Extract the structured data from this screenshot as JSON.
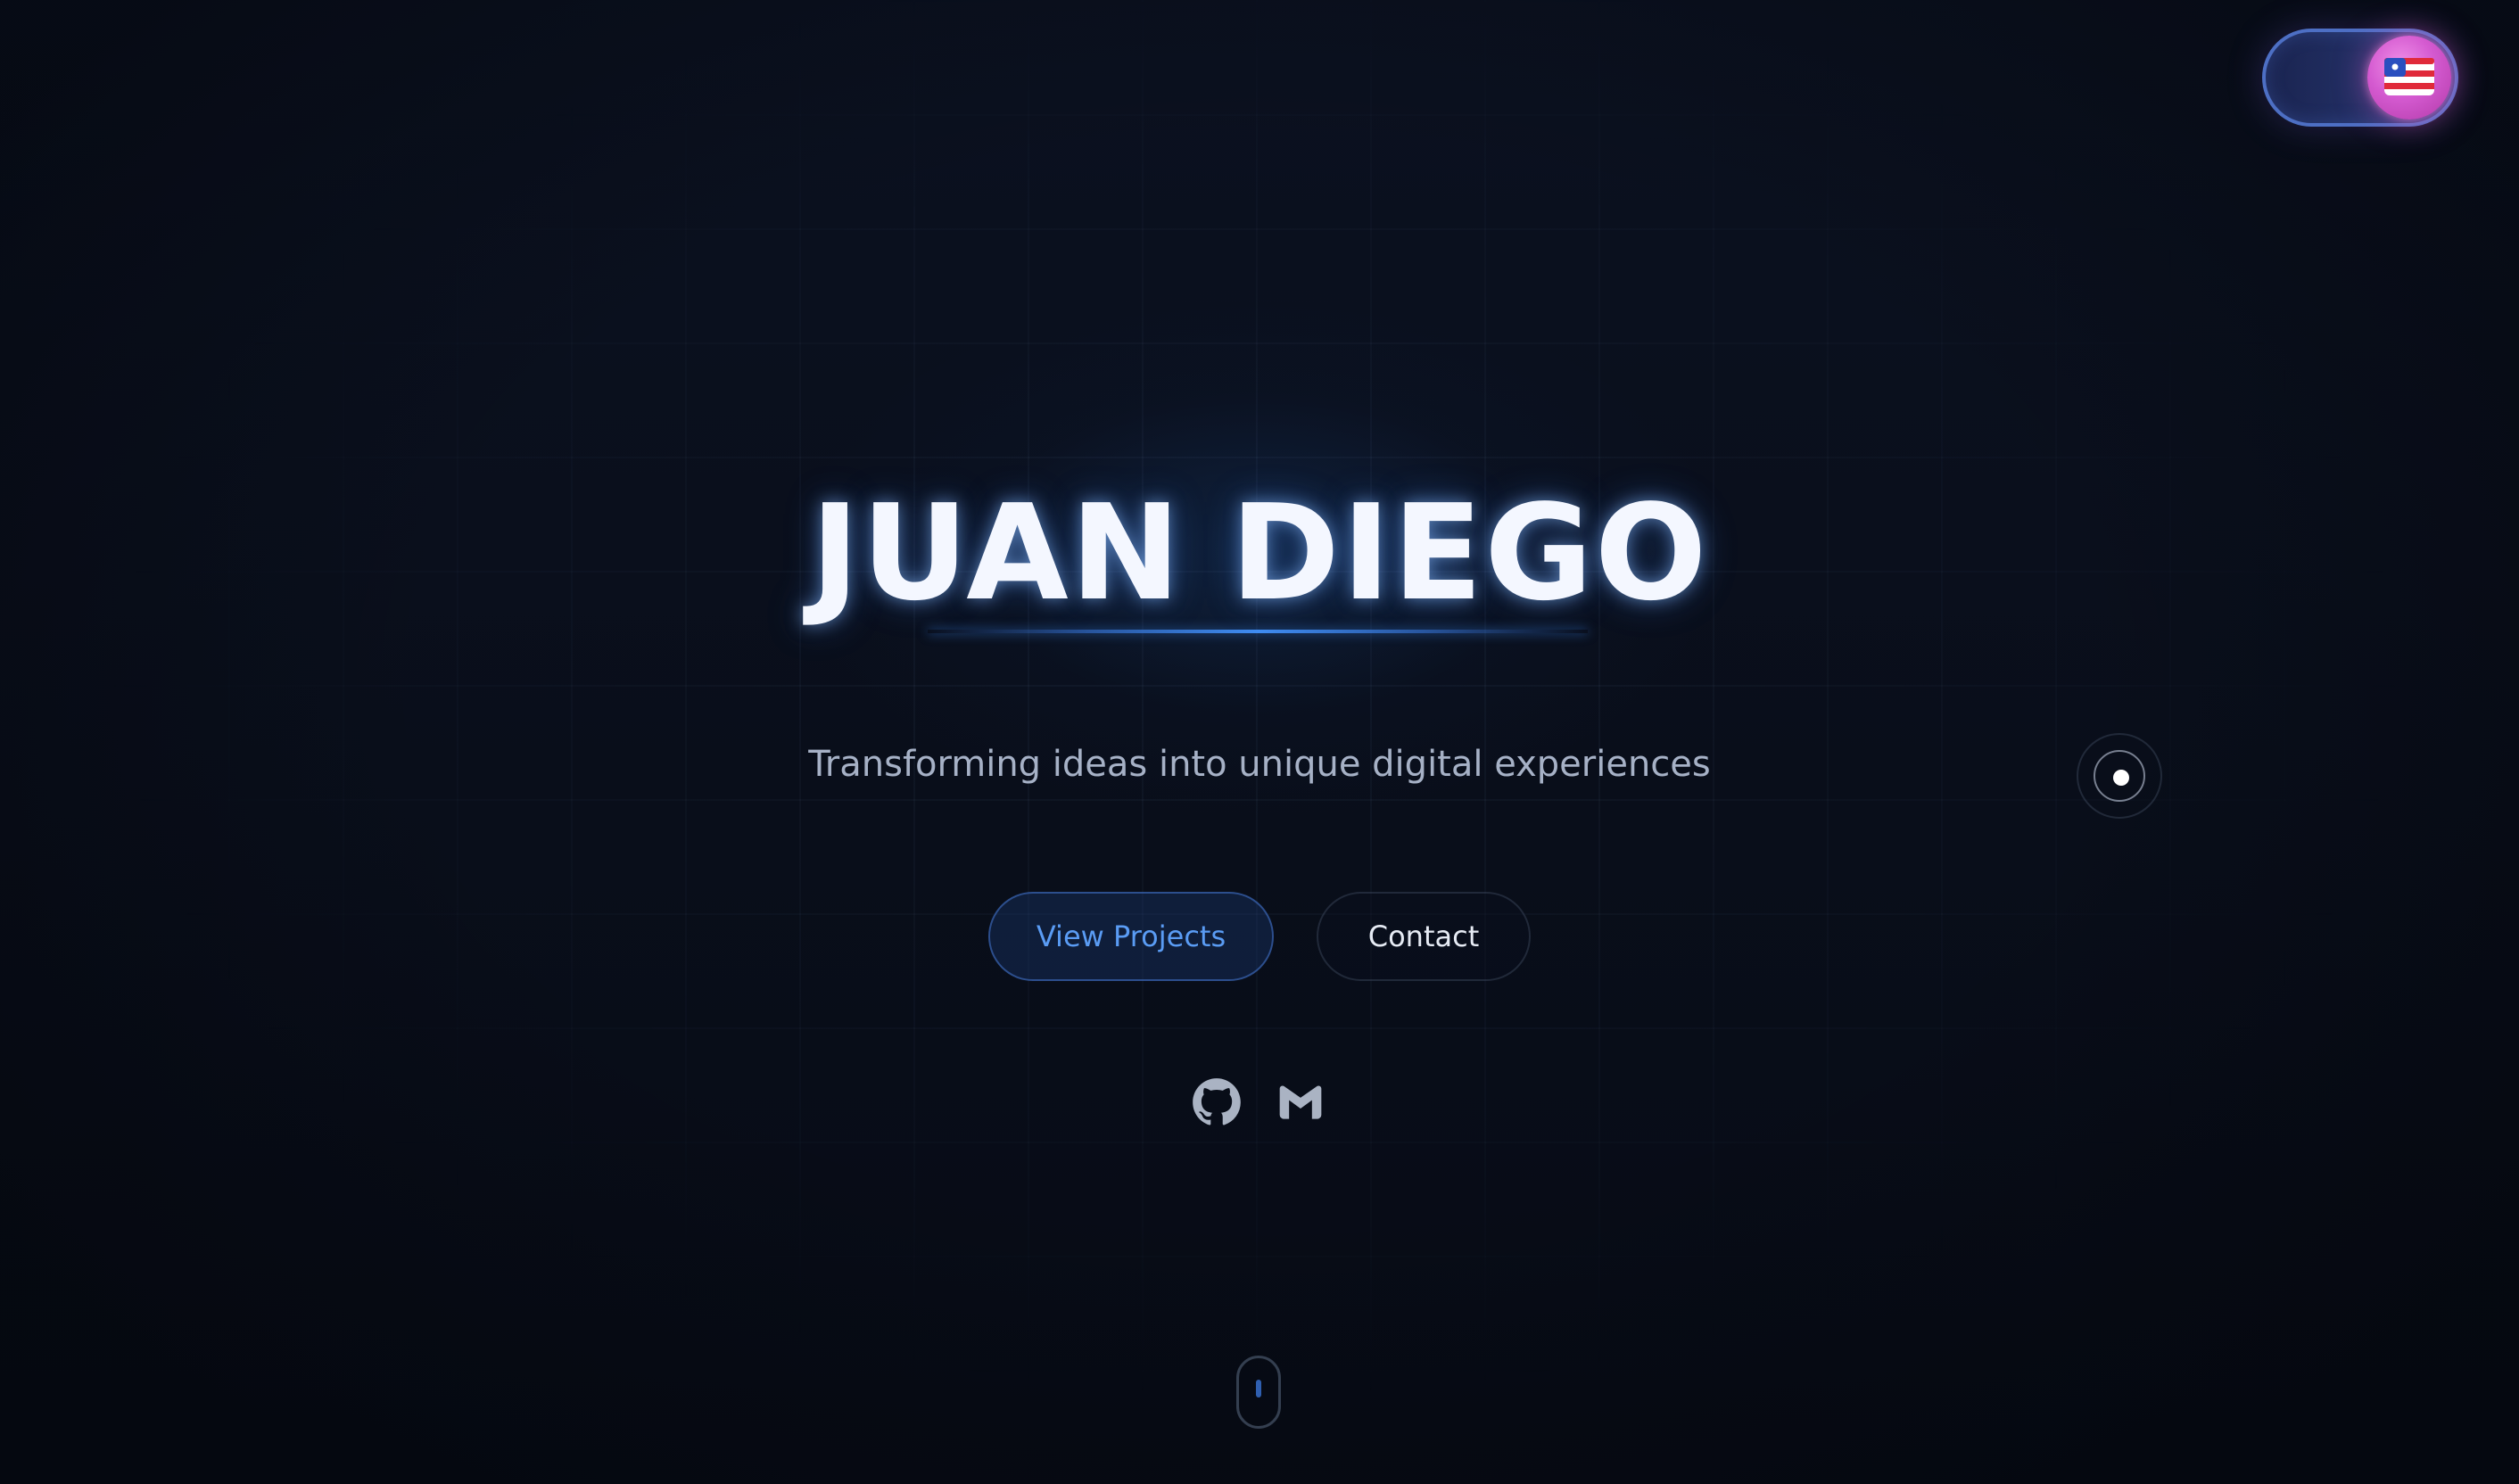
{
  "hero": {
    "title": "JUAN DIEGO",
    "subtitle": "Transforming ideas into unique digital experiences"
  },
  "buttons": {
    "view_projects": "View Projects",
    "contact": "Contact"
  },
  "social": {
    "icons": [
      "github-icon",
      "gmail-icon"
    ]
  },
  "language_toggle": {
    "flag_icon": "us-flag-icon"
  },
  "colors": {
    "background": "#0a0f1c",
    "accent_blue": "#3f8cf2",
    "toggle_knob": "#d45ad0",
    "subtitle_text": "#a6b1c6"
  }
}
